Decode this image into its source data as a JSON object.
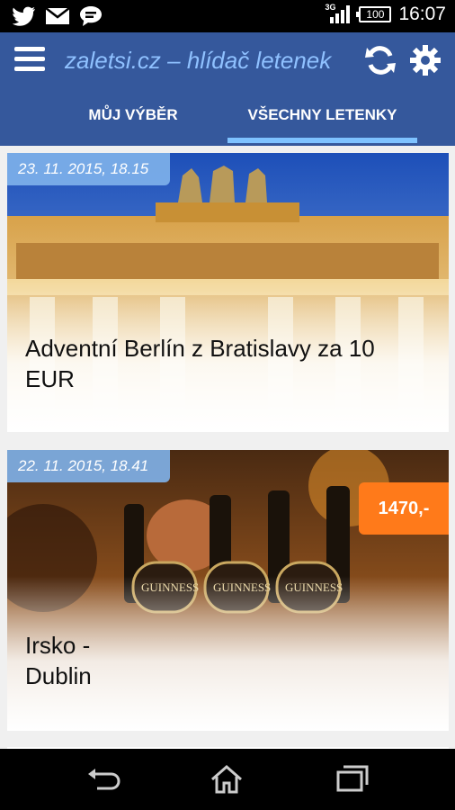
{
  "status_bar": {
    "network_tag": "3G",
    "battery": "100",
    "time": "16:07",
    "icons": [
      "twitter-icon",
      "mail-icon",
      "chat-icon",
      "signal-icon",
      "battery-icon"
    ]
  },
  "app_bar": {
    "title": "zaletsi.cz – hlídač letenek",
    "icons": [
      "menu-icon",
      "refresh-icon",
      "gear-icon"
    ],
    "color": "#35589c",
    "title_color": "#8fc1ff"
  },
  "tabs": [
    {
      "label": "MŮJ VÝBĚR",
      "selected": false
    },
    {
      "label": "VŠECHNY LETENKY",
      "selected": true
    }
  ],
  "cards": [
    {
      "date": "23. 11. 2015, 18.15",
      "title": "Adventní Berlín z Bratislavy za 10 EUR",
      "image": "berlin-gate-image"
    },
    {
      "date": "22. 11. 2015, 18.41",
      "title": "Irsko - Dublin",
      "price": "1470,-",
      "image": "guinness-bar-image"
    }
  ],
  "nav_bar": {
    "icons": [
      "back-icon",
      "home-icon",
      "recent-apps-icon"
    ]
  },
  "colors": {
    "accent_tab_indicator": "#7ec2ff",
    "date_badge": "#80b2eb",
    "price_badge": "#ff7a1a"
  }
}
